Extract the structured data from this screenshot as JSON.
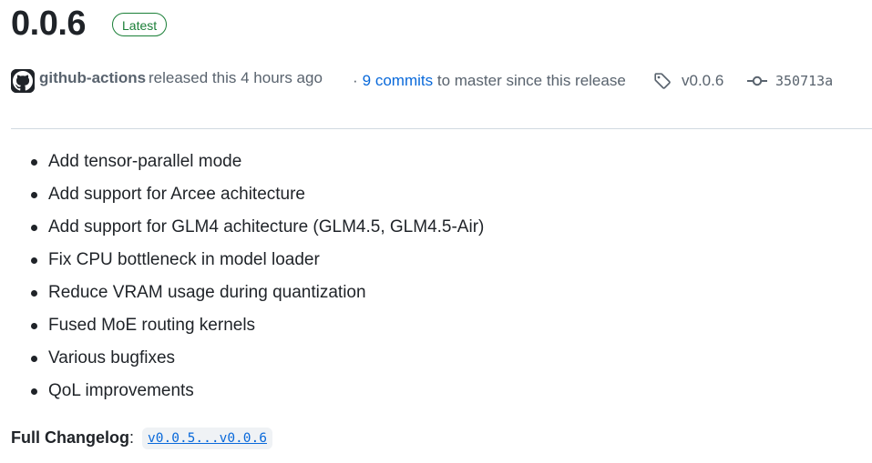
{
  "release": {
    "title": "0.0.6",
    "badge": "Latest"
  },
  "meta": {
    "avatar_icon": "github-octocat-icon",
    "author": "github-actions",
    "released_text": "released this 4 hours ago",
    "commits_separator": "·",
    "commits_link": "9 commits",
    "commits_suffix": "to master since this release",
    "tag_icon": "tag-icon",
    "tag": "v0.0.6",
    "commit_icon": "git-commit-icon",
    "commit_sha": "350713a"
  },
  "notes": [
    "Add tensor-parallel mode",
    "Add support for Arcee achitecture",
    "Add support for GLM4 achitecture (GLM4.5, GLM4.5-Air)",
    "Fix CPU bottleneck in model loader",
    "Reduce VRAM usage during quantization",
    "Fused MoE routing kernels",
    "Various bugfixes",
    "QoL improvements"
  ],
  "changelog": {
    "label": "Full Changelog",
    "separator": ":",
    "link": "v0.0.5...v0.0.6"
  },
  "colors": {
    "text": "#1f2328",
    "muted": "#59636e",
    "link": "#0969da",
    "badge_green": "#1a7f37",
    "divider": "#d1d9e0"
  }
}
